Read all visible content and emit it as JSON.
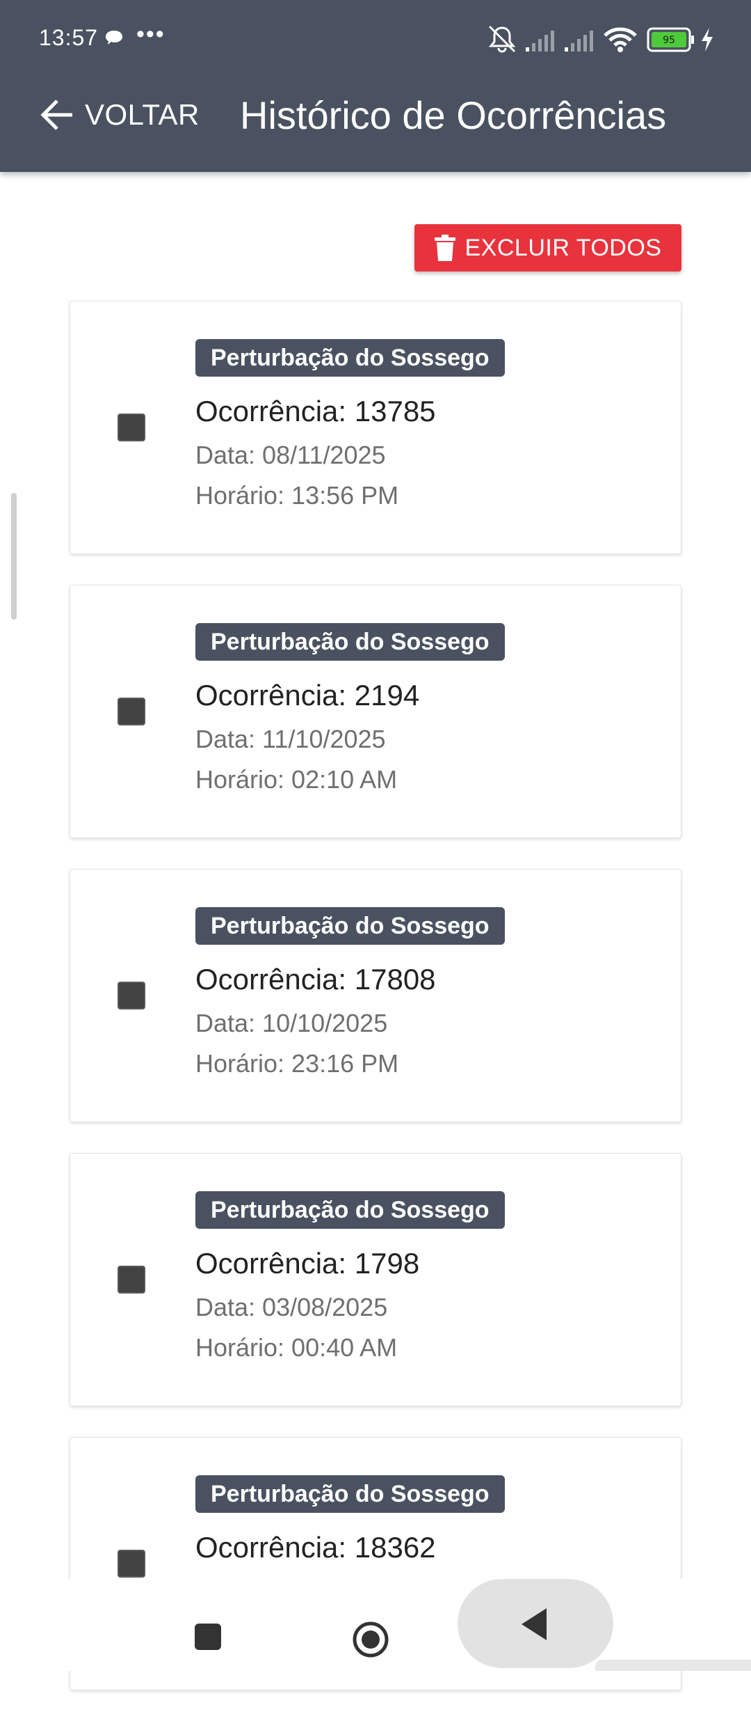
{
  "status_bar": {
    "time": "13:57",
    "battery_level": "95",
    "icons": [
      "chat-bubble-icon",
      "more-dots-icon",
      "mute-icon",
      "signal-icon",
      "signal-icon",
      "wifi-icon",
      "battery-icon",
      "charging-icon"
    ]
  },
  "header": {
    "back_label": "VOLTAR",
    "title": "Histórico de Ocorrências"
  },
  "actions": {
    "delete_all_label": "EXCLUIR TODOS"
  },
  "occurrences": [
    {
      "category": "Perturbação do Sossego",
      "title": "Ocorrência: 13785",
      "date": "Data: 08/11/2025",
      "time": "Horário: 13:56 PM"
    },
    {
      "category": "Perturbação do Sossego",
      "title": "Ocorrência: 2194",
      "date": "Data: 11/10/2025",
      "time": "Horário: 02:10 AM"
    },
    {
      "category": "Perturbação do Sossego",
      "title": "Ocorrência: 17808",
      "date": "Data: 10/10/2025",
      "time": "Horário: 23:16 PM"
    },
    {
      "category": "Perturbação do Sossego",
      "title": "Ocorrência: 1798",
      "date": "Data: 03/08/2025",
      "time": "Horário: 00:40 AM"
    },
    {
      "category": "Perturbação do Sossego",
      "title": "Ocorrência: 18362",
      "date": "",
      "time": ""
    }
  ],
  "colors": {
    "header_bg": "#4a5261",
    "danger": "#e8333d",
    "badge_bg": "#4a5261",
    "checkbox": "#424242"
  }
}
